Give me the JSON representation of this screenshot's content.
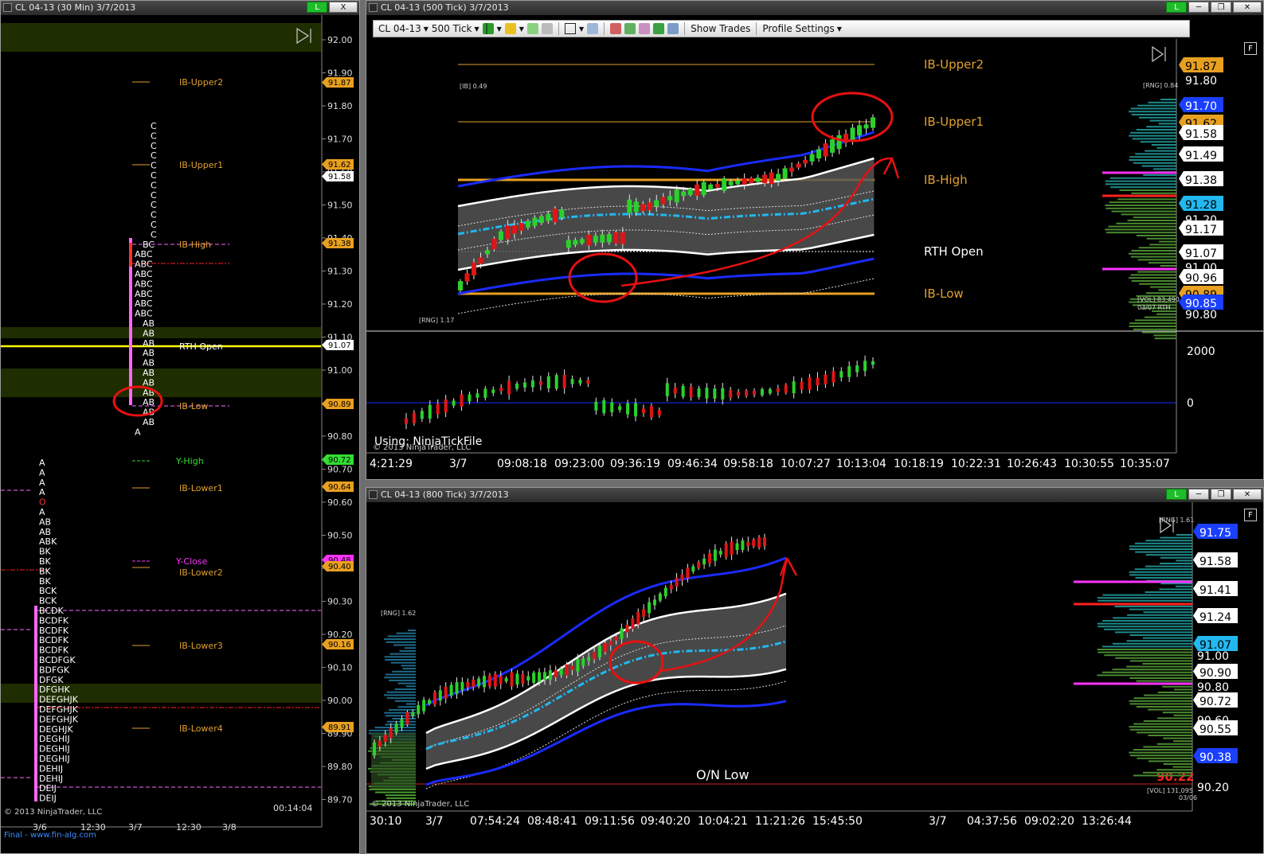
{
  "left_window": {
    "title": "CL 04-13 (30 Min)  3/7/2013",
    "connection_label": "L",
    "close_label": "X",
    "price_ticks": [
      "92.00",
      "91.90",
      "91.80",
      "91.70",
      "91.60",
      "91.50",
      "91.40",
      "91.30",
      "91.20",
      "91.10",
      "91.00",
      "90.90",
      "90.80",
      "90.70",
      "90.60",
      "90.50",
      "90.40",
      "90.30",
      "90.20",
      "90.10",
      "90.00",
      "89.90",
      "89.80",
      "89.70"
    ],
    "level_labels": [
      {
        "text": "IB-Upper2",
        "color": "#e0a030"
      },
      {
        "text": "IB-Upper1",
        "color": "#e0a030"
      },
      {
        "text": "IB-High",
        "color": "#e0a030"
      },
      {
        "text": "RTH Open",
        "color": "#ffffff"
      },
      {
        "text": "IB-Low",
        "color": "#e0a030"
      },
      {
        "text": "Y-High",
        "color": "#33dd33"
      },
      {
        "text": "IB-Lower1",
        "color": "#e0a030"
      },
      {
        "text": "Y-Close",
        "color": "#ff33ff"
      },
      {
        "text": "IB-Lower2",
        "color": "#e0a030"
      },
      {
        "text": "IB-Lower3",
        "color": "#e0a030"
      },
      {
        "text": "IB-Lower4",
        "color": "#e0a030"
      }
    ],
    "price_tags": [
      "91.87",
      "91.62",
      "91.58",
      "91.38",
      "91.07",
      "90.89",
      "90.72",
      "90.64",
      "90.48",
      "90.40",
      "90.16",
      "89.91"
    ],
    "profile_top": [
      "C",
      "C",
      "C",
      "C",
      "C",
      "C",
      "C",
      "C",
      "C",
      "C",
      "C",
      "C",
      "BC",
      "ABC",
      "ABC",
      "ABC",
      "ABC",
      "ABC",
      "ABC",
      "ABC",
      "AB",
      "AB",
      "AB",
      "AB",
      "AB",
      "AB",
      "AB",
      "AB",
      "AB",
      "AB",
      "AB",
      "A"
    ],
    "profile_bottom": [
      "A",
      "A",
      "A",
      "A",
      "O",
      "A",
      "AB",
      "AB",
      "ABK",
      "BK",
      "BK",
      "BK",
      "BK",
      "BCK",
      "BCK",
      "BCDK",
      "BCDFK",
      "BCDFK",
      "BCDFK",
      "BCDFK",
      "BCDFGK",
      "BDFGK",
      "DFGK",
      "DFGHK",
      "DEFGHJK",
      "DEFGHJK",
      "DEFGHJK",
      "DEGHJK",
      "DEGHIJ",
      "DEGHIJ",
      "DEGHIJ",
      "DEHIJ",
      "DEHIJ",
      "DEIJ",
      "DEIJ"
    ],
    "time_labels": [
      "3/6",
      "12:30",
      "3/7",
      "12:30",
      "3/8"
    ],
    "copyright": "© 2013 NinjaTrader, LLC",
    "clock": "00:14:04",
    "footer_link": "Final - www.fin-alg.com"
  },
  "top_window": {
    "title": "CL 04-13 (500 Tick)  3/7/2013",
    "connection_label": "L",
    "toolbar": {
      "instrument": "CL 04-13",
      "interval": "500 Tick",
      "show_trades": "Show Trades",
      "profile_settings": "Profile Settings"
    },
    "f_label": "F",
    "level_labels": [
      {
        "text": "IB-Upper2",
        "color": "#e0a030"
      },
      {
        "text": "IB-Upper1",
        "color": "#e0a030"
      },
      {
        "text": "IB-High",
        "color": "#e0a030"
      },
      {
        "text": "RTH Open",
        "color": "#ffffff"
      },
      {
        "text": "IB-Low",
        "color": "#e0a030"
      }
    ],
    "price_ticks": [
      "91.80",
      "91.20",
      "91.00",
      "90.80"
    ],
    "price_tags": [
      {
        "text": "91.87",
        "bg": "#e8a020",
        "fg": "#000"
      },
      {
        "text": "91.70",
        "bg": "#1a3fff",
        "fg": "#fff"
      },
      {
        "text": "91.62",
        "bg": "#e8a020",
        "fg": "#000"
      },
      {
        "text": "91.58",
        "bg": "#ffffff",
        "fg": "#000"
      },
      {
        "text": "91.49",
        "bg": "#ffffff",
        "fg": "#000"
      },
      {
        "text": "91.38",
        "bg": "#ffffff",
        "fg": "#000"
      },
      {
        "text": "91.28",
        "bg": "#22b8f0",
        "fg": "#000"
      },
      {
        "text": "91.17",
        "bg": "#ffffff",
        "fg": "#000"
      },
      {
        "text": "91.07",
        "bg": "#ffffff",
        "fg": "#000"
      },
      {
        "text": "90.96",
        "bg": "#ffffff",
        "fg": "#000"
      },
      {
        "text": "90.89",
        "bg": "#e8a020",
        "fg": "#000"
      },
      {
        "text": "90.85",
        "bg": "#1a3fff",
        "fg": "#fff"
      }
    ],
    "ib_label": "[IB] 0.49",
    "rng_label": "[RNG] 1.17",
    "rng_right": "[RNG] 0.84",
    "vol_label": "[VOL] 83,490",
    "vol_date": "03/07 RTH",
    "sub_ticks": [
      "2000",
      "0"
    ],
    "using_label": "Using: NinjaTickFile",
    "copyright": "© 2013 NinjaTrader, LLC",
    "time_labels": [
      "4:21:29",
      "3/7",
      "09:08:18",
      "09:23:00",
      "09:36:19",
      "09:46:34",
      "09:58:18",
      "10:07:27",
      "10:13:04",
      "10:18:19",
      "10:22:31",
      "10:26:43",
      "10:30:55",
      "10:35:07"
    ]
  },
  "bottom_window": {
    "title": "CL 04-13 (800 Tick)  3/7/2013",
    "connection_label": "L",
    "f_label": "F",
    "rng_label": "[RNG] 1.62",
    "rng_right": "[RNG] 1.61",
    "on_low_label": "O/N Low",
    "on_low_price": "90.22",
    "price_ticks": [
      "91.00",
      "90.80",
      "90.60",
      "90.20"
    ],
    "price_tags": [
      {
        "text": "91.75",
        "bg": "#1a3fff",
        "fg": "#fff"
      },
      {
        "text": "91.58",
        "bg": "#ffffff",
        "fg": "#000"
      },
      {
        "text": "91.41",
        "bg": "#ffffff",
        "fg": "#000"
      },
      {
        "text": "91.24",
        "bg": "#ffffff",
        "fg": "#000"
      },
      {
        "text": "91.07",
        "bg": "#22b8f0",
        "fg": "#000"
      },
      {
        "text": "90.90",
        "bg": "#ffffff",
        "fg": "#000"
      },
      {
        "text": "90.72",
        "bg": "#ffffff",
        "fg": "#000"
      },
      {
        "text": "90.55",
        "bg": "#ffffff",
        "fg": "#000"
      },
      {
        "text": "90.38",
        "bg": "#1a3fff",
        "fg": "#fff"
      }
    ],
    "vol_label": "[VOL] 131,095",
    "vol_date": "03/06",
    "copyright": "© 2013 NinjaTrader, LLC",
    "time_labels": [
      "30:10",
      "3/7",
      "07:54:24",
      "08:48:41",
      "09:11:56",
      "09:40:20",
      "10:04:21",
      "11:21:26",
      "15:45:50",
      "3/7",
      "04:37:56",
      "09:02:20",
      "13:26:44"
    ]
  }
}
